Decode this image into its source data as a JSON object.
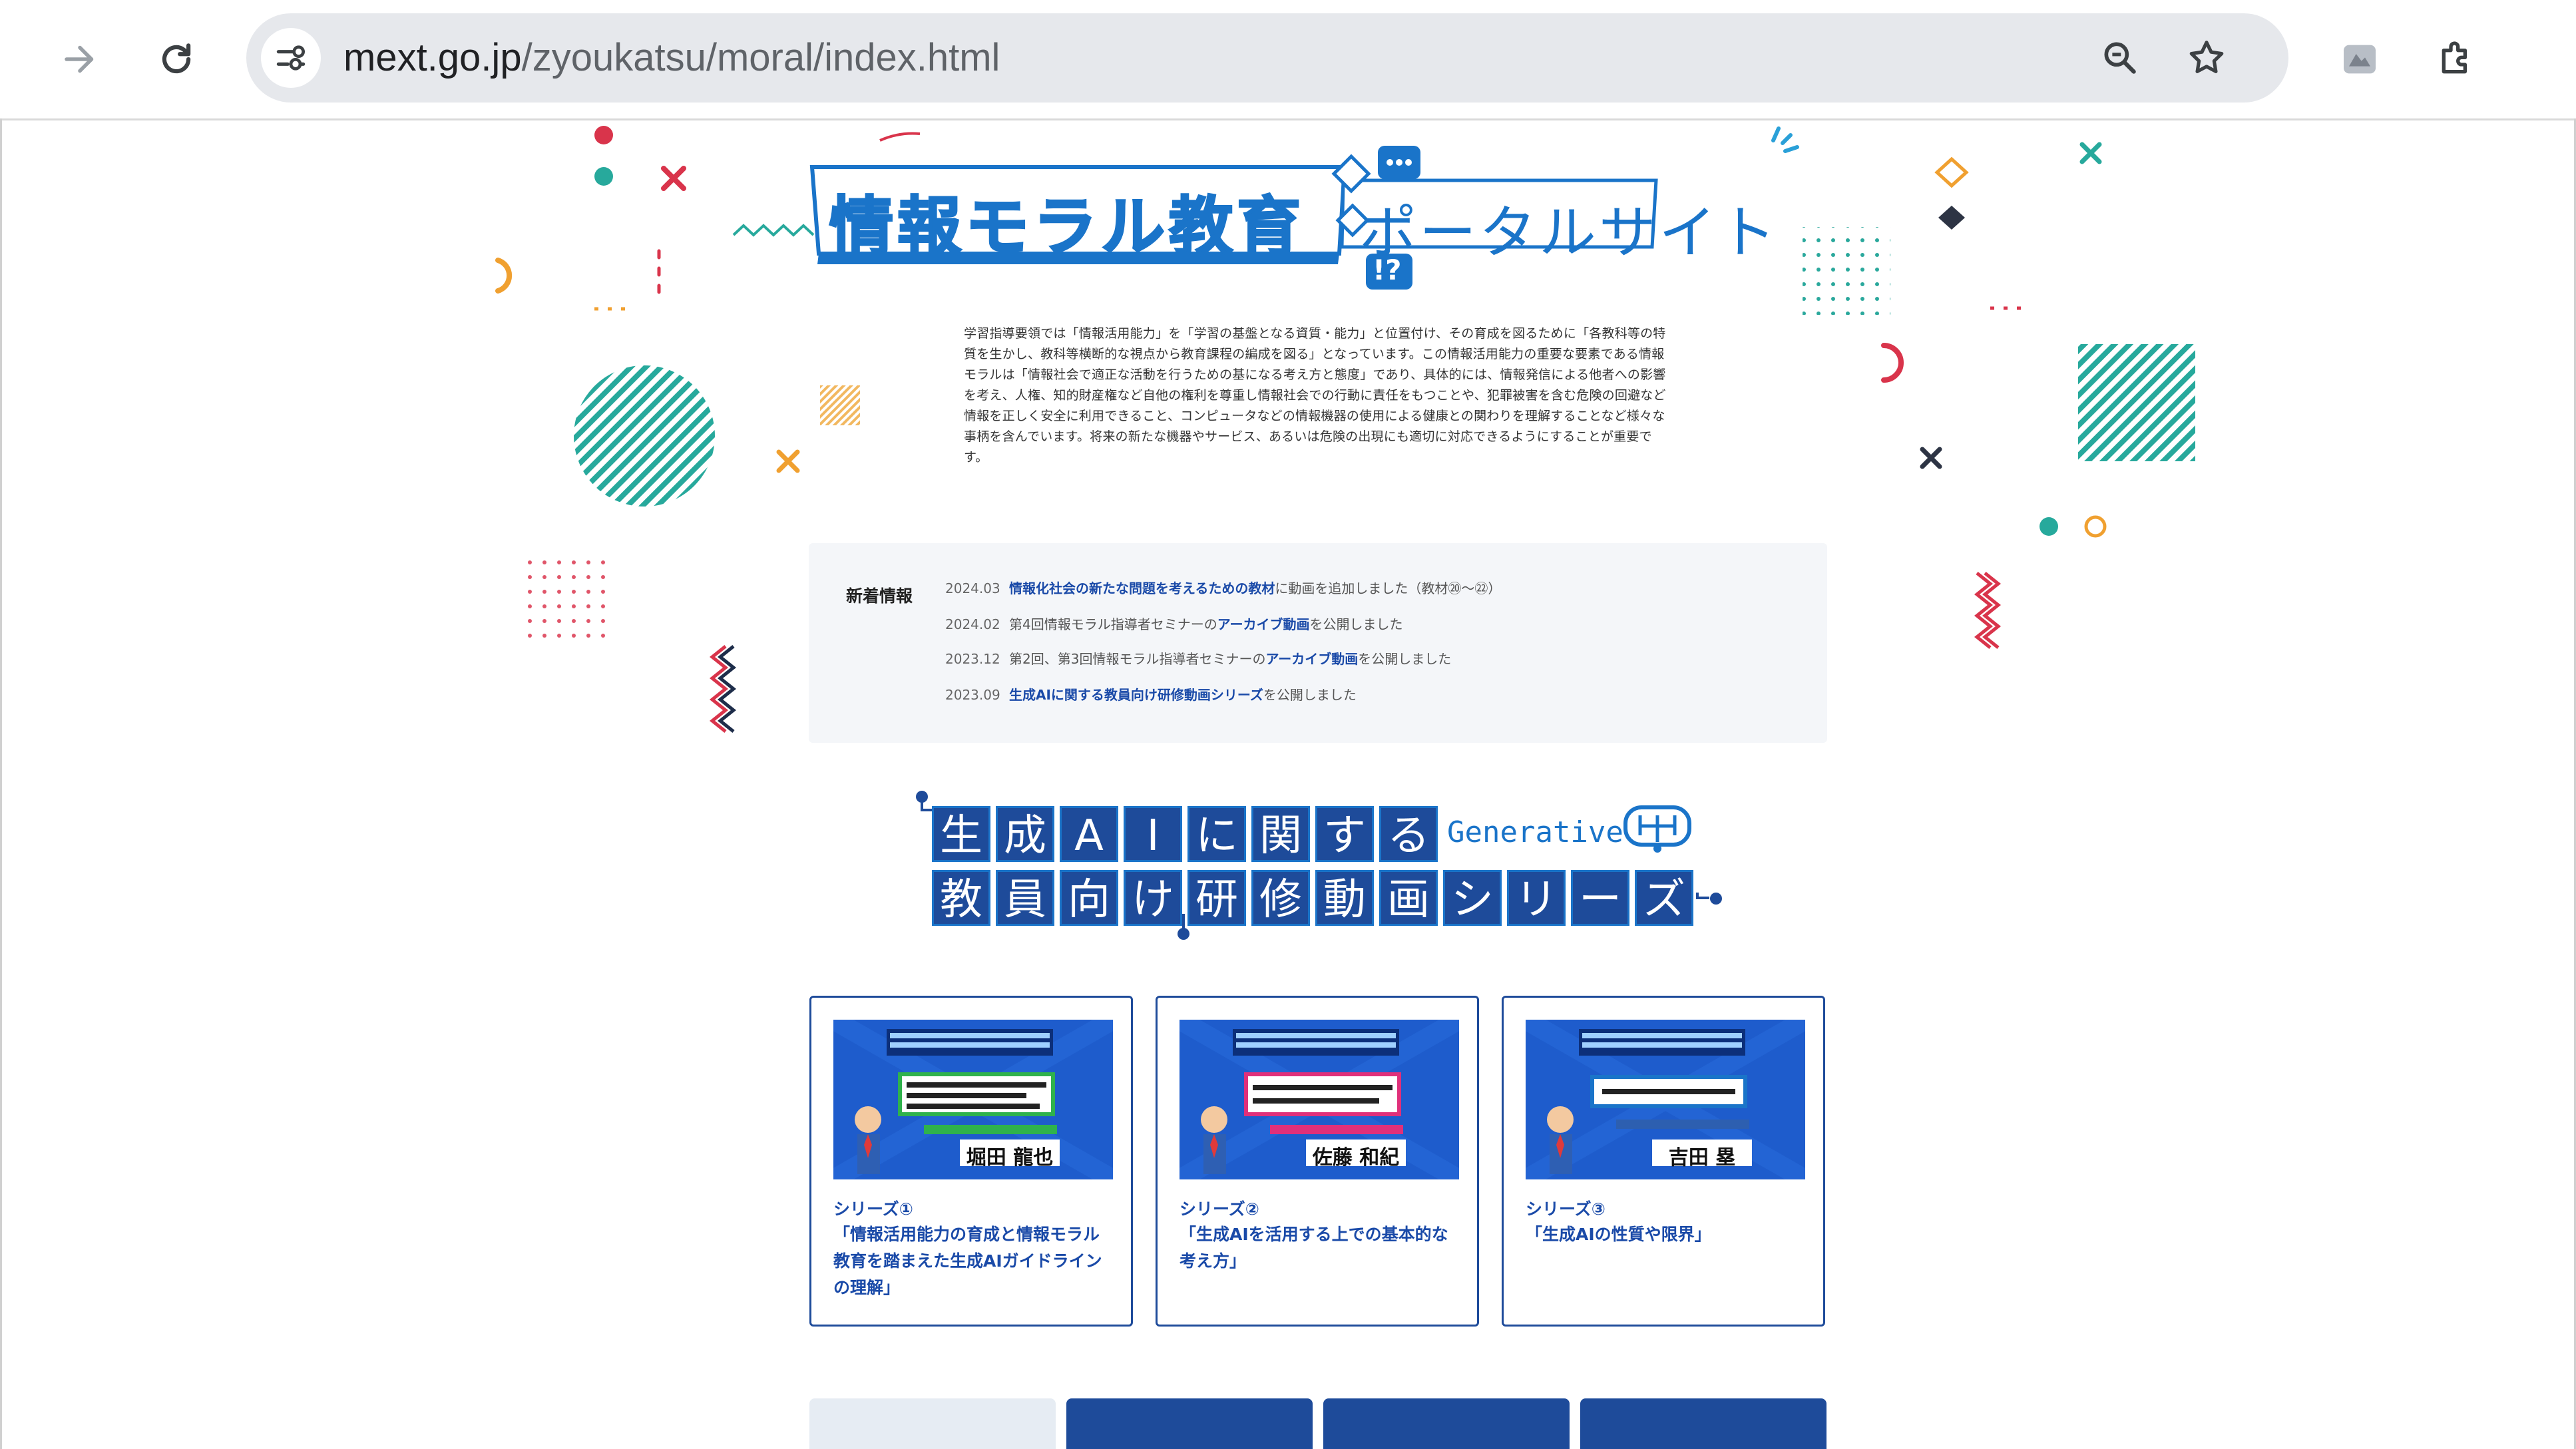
{
  "browser": {
    "url_host": "mext.go.jp",
    "url_path": "/zyoukatsu/moral/index.html",
    "icons": [
      "forward-icon",
      "reload-icon",
      "site-info-icon",
      "zoom-icon",
      "bookmark-star-icon",
      "extension-avatar-icon",
      "extensions-icon"
    ]
  },
  "header": {
    "title_main": "情報モラル教育",
    "title_sub": "ポータルサイト",
    "badge": "!?"
  },
  "intro": {
    "text": "学習指導要領では「情報活用能力」を「学習の基盤となる資質・能力」と位置付け、その育成を図るために「各教科等の特質を生かし、教科等横断的な視点から教育課程の編成を図る」となっています。この情報活用能力の重要な要素である情報モラルは「情報社会で適正な活動を行うための基になる考え方と態度」であり、具体的には、情報発信による他者への影響を考え、人権、知的財産権など自他の権利を尊重し情報社会での行動に責任をもつことや、犯罪被害を含む危険の回避など情報を正しく安全に利用できること、コンピュータなどの情報機器の使用による健康との関わりを理解することなど様々な事柄を含んでいます。将来の新たな機器やサービス、あるいは危険の出現にも適切に対応できるようにすることが重要です。"
  },
  "news": {
    "heading": "新着情報",
    "items": [
      {
        "date": "2024.03",
        "link": "情報化社会の新たな問題を考えるための教材",
        "text": "に動画を追加しました（教材⑳〜㉒）"
      },
      {
        "date": "2024.02",
        "pre": "第4回情報モラル指導者セミナーの",
        "link": "アーカイブ動画",
        "text": "を公開しました"
      },
      {
        "date": "2023.12",
        "pre": "第2回、第3回情報モラル指導者セミナーの",
        "link": "アーカイブ動画",
        "text": "を公開しました"
      },
      {
        "date": "2023.09",
        "link": "生成AIに関する教員向け研修動画シリーズ",
        "text": "を公開しました"
      }
    ]
  },
  "genai": {
    "row1": [
      "生",
      "成",
      "A",
      "I",
      "に",
      "関",
      "す",
      "る"
    ],
    "row2": [
      "教",
      "員",
      "向",
      "け",
      "研",
      "修",
      "動",
      "画",
      "シ",
      "リ",
      "ー",
      "ズ"
    ],
    "tag": "Generative AI"
  },
  "cards": [
    {
      "series": "シリーズ①",
      "title": "「情報活用能力の育成と情報モラル教育を踏まえた生成AIガイドラインの理解」",
      "thumb_caption": "堀田 龍也"
    },
    {
      "series": "シリーズ②",
      "title": "「生成AIを活用する上での基本的な考え方」",
      "thumb_caption": "佐藤 和紀"
    },
    {
      "series": "シリーズ③",
      "title": "「生成AIの性質や限界」",
      "thumb_caption": "吉田 塁"
    }
  ],
  "colors": {
    "accent": "#1a74c9",
    "teal": "#26a69a",
    "red": "#d9344b",
    "orange": "#f0a030",
    "navy": "#1e4b9a"
  }
}
